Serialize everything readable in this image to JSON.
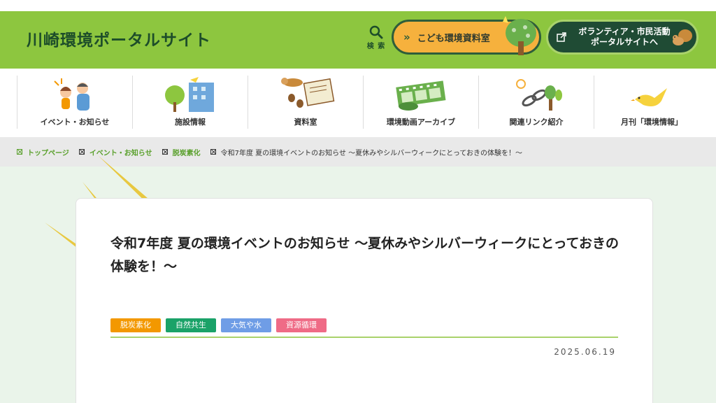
{
  "header": {
    "site_title": "川崎環境ポータルサイト",
    "search_label": "検 索",
    "kids_button": {
      "chevron": "»",
      "label": "こども環境資料室",
      "icon": "tree-icon"
    },
    "volunteer_button": {
      "label_line1": "ボランティア・市民活動",
      "label_line2": "ポータルサイトへ",
      "icon": "external-link-icon"
    }
  },
  "nav": [
    {
      "label": "イベント・お知らせ",
      "icon": "family-icon"
    },
    {
      "label": "施設情報",
      "icon": "building-icon"
    },
    {
      "label": "資料室",
      "icon": "book-squirrel-icon"
    },
    {
      "label": "環境動画アーカイブ",
      "icon": "film-icon"
    },
    {
      "label": "関連リンク紹介",
      "icon": "chain-icon"
    },
    {
      "label": "月刊「環境情報」",
      "icon": "bird-icon"
    }
  ],
  "breadcrumb": {
    "home": "トップページ",
    "level1": "イベント・お知らせ",
    "level2": "脱炭素化",
    "current": "令和7年度 夏の環境イベントのお知らせ ～夏休みやシルバーウィークにとっておきの体験を！～"
  },
  "article": {
    "title": "令和7年度 夏の環境イベントのお知らせ ～夏休みやシルバーウィークにとっておきの体験を！～",
    "tags": [
      {
        "label": "脱炭素化",
        "color": "#f39800"
      },
      {
        "label": "自然共生",
        "color": "#1aa268"
      },
      {
        "label": "大気や水",
        "color": "#6f9de6"
      },
      {
        "label": "資源循環",
        "color": "#ef6b86"
      }
    ],
    "date": "2025.06.19"
  },
  "colors": {
    "header_bg": "#8dc63f",
    "title_green": "#1d4d2a",
    "accent_orange": "#f6b13d",
    "dark_green": "#1f4b34"
  }
}
